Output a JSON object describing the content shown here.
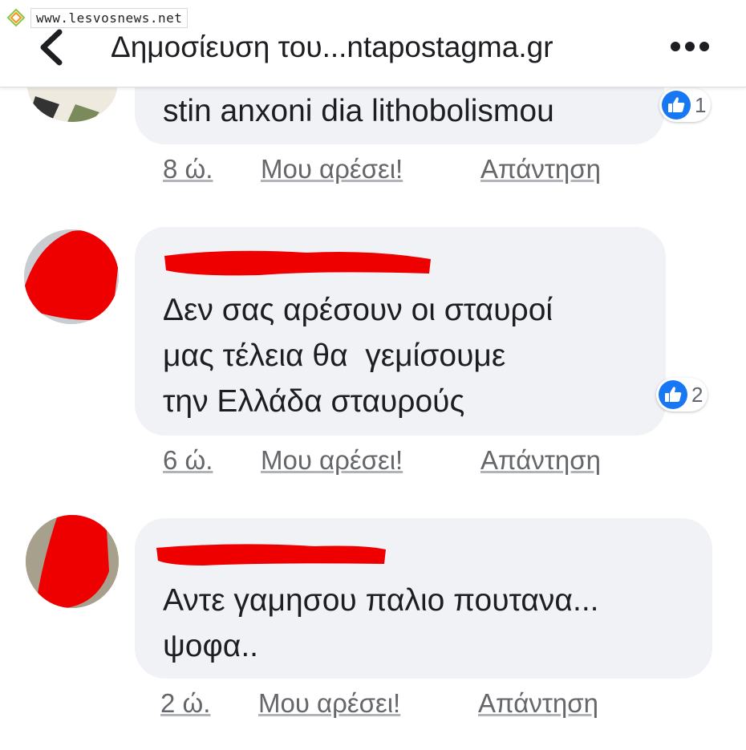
{
  "watermark": {
    "site": "www.lesvosnews.net"
  },
  "header": {
    "title": "Δημοσίευση του...ntapostagma.gr",
    "back_icon": "chevron-left-icon",
    "more_icon": "more-dots-icon"
  },
  "colors": {
    "bubble": "#f0f2f5",
    "like_blue": "#1877f2",
    "redaction": "#ee0000",
    "action_text": "#65676b"
  },
  "comments": [
    {
      "text": "stin anxoni dia lithobolismou",
      "reactions": "1",
      "time": "8 ώ.",
      "like_label": "Μου αρέσει!",
      "reply_label": "Απάντηση"
    },
    {
      "text": "Δεν σας αρέσουν οι σταυροί\nμας τέλεια θα  γεμίσουμε\nτην Ελλάδα σταυρούς",
      "reactions": "2",
      "time": "6 ώ.",
      "like_label": "Μου αρέσει!",
      "reply_label": "Απάντηση"
    },
    {
      "text": "Αντε γαμησου παλιο πουτανα...\nψοφα..",
      "time": "2 ώ.",
      "like_label": "Μου αρέσει!",
      "reply_label": "Απάντηση"
    }
  ]
}
